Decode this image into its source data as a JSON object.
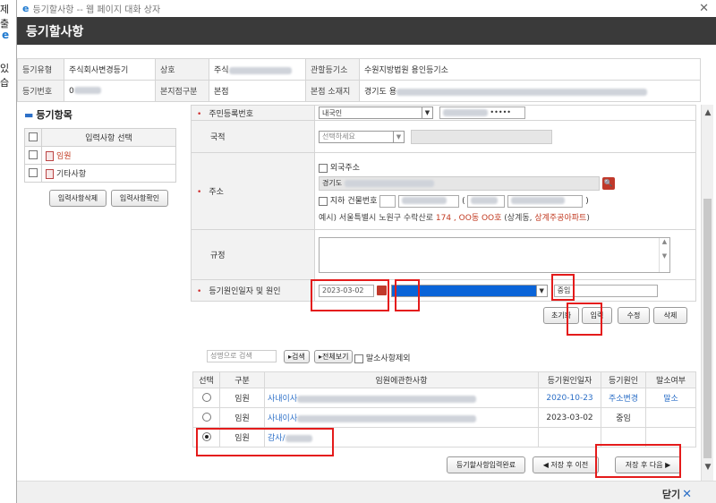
{
  "background": {
    "text_top": "제출",
    "text_mid": "있습",
    "ie_glyph": "e"
  },
  "titlebar": {
    "ie_glyph": "e",
    "title": "등기할사항 -- 웹 페이지 대화 상자",
    "close_glyph": "✕"
  },
  "header": {
    "title": "등기할사항"
  },
  "info": {
    "type_label": "등기유형",
    "type_value": "주식회사변경등기",
    "name_label": "상호",
    "name_value_prefix": "주식",
    "court_label": "관할등기소",
    "court_value": "수원지방법원 용인등기소",
    "regno_label": "등기번호",
    "regno_prefix": "0",
    "branch_label": "본지점구분",
    "branch_value": "본점",
    "addr_label": "본점 소재지",
    "addr_prefix": "경기도 용"
  },
  "left_panel": {
    "title": "등기항목",
    "header": "입력사항 선택",
    "items": [
      "임원",
      "기타사항"
    ],
    "delete_btn": "입력사항삭제",
    "confirm_btn": "입력사항확인"
  },
  "form": {
    "rrn_label": "주민등록번호",
    "rrn_type": "내국인",
    "rrn_tail": "•••••",
    "nationality_label": "국적",
    "nationality_placeholder": "선택하세요",
    "address_label": "주소",
    "foreign_addr": "외국주소",
    "addr_value_prefix": "경기도",
    "underground": "지하",
    "building_no": "건물번호",
    "paren_open": "(",
    "paren_close": ")",
    "example_prefix": "예시) 서울특별시 노원구 수락산로 ",
    "example_red": "174 , OO동 OO호",
    "example_mid": " (상계동, ",
    "example_red2": "상계주공아파트",
    "example_end": ")",
    "rule_label": "규정",
    "cause_label": "등기원인일자 및 원인",
    "cause_date": "2023-03-02",
    "cause_text": "중임"
  },
  "actions": {
    "reset": "초기화",
    "input": "입력",
    "edit": "수정",
    "delete": "삭제"
  },
  "search": {
    "placeholder": "성명으로 검색",
    "search_btn": "검색",
    "view_all_btn": "전체보기",
    "exclude_label": "말소사항제외"
  },
  "list": {
    "headers": [
      "선택",
      "구분",
      "임원에관한사항",
      "등기원인일자",
      "등기원인",
      "말소여부"
    ],
    "rows": [
      {
        "type": "임원",
        "desc_prefix": "사내이사",
        "date": "2020-10-23",
        "cause": "주소변경",
        "cancel": "말소"
      },
      {
        "type": "임원",
        "desc_prefix": "사내이사",
        "date": "2023-03-02",
        "cause": "중임",
        "cancel": ""
      },
      {
        "type": "임원",
        "desc_prefix": "감사/",
        "date": "",
        "cause": "",
        "cancel": ""
      }
    ]
  },
  "bottom_buttons": {
    "complete": "등기할사항입력완료",
    "save_prev": "저장 후 이전",
    "save_next": "저장 후 다음"
  },
  "footer": {
    "close": "닫기"
  },
  "colors": {
    "highlight_box": "#e41b1b",
    "selection_blue": "#0a64d8"
  }
}
